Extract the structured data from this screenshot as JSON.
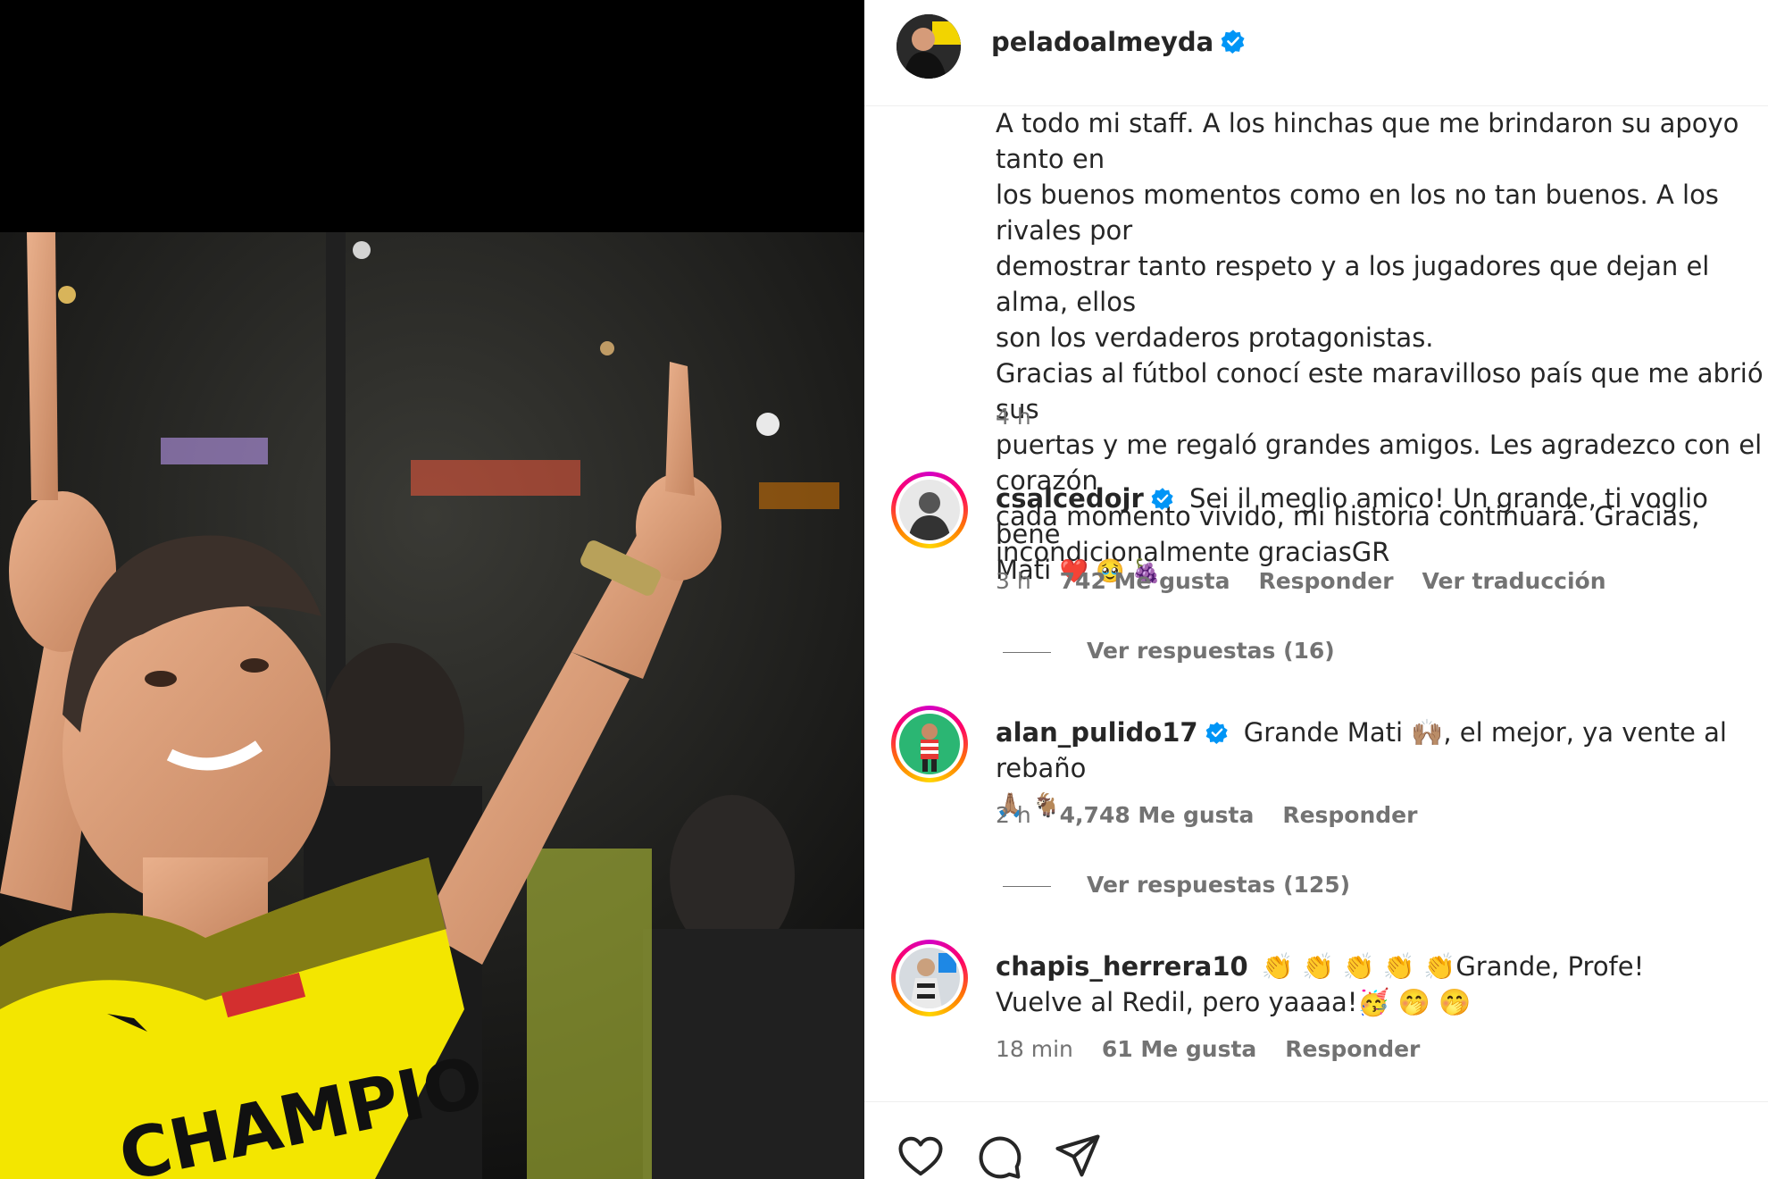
{
  "post": {
    "username": "peladoalmeyda",
    "caption": "A todo mi staff. A los hinchas que me brindaron su apoyo tanto en\nlos buenos momentos como en los no tan buenos. A los rivales por\ndemostrar tanto respeto y a los jugadores que dejan el alma, ellos\nson los verdaderos protagonistas.\nGracias al fútbol conocí este maravilloso país que me abrió sus\npuertas y me regaló grandes amigos. Les agradezco con el corazón\ncada momento vivido, mi historia continuará. Gracias,\nincondicionalmente graciasGR",
    "time": "4 h"
  },
  "comments": [
    {
      "username": "csalcedojr",
      "text": "Sei il meglio amico! Un grande, ti voglio bene",
      "text2": "Mati",
      "emoji": "❤️ 🥹 🍇",
      "time": "3 h",
      "likes": "742 Me gusta",
      "reply": "Responder",
      "translate": "Ver traducción",
      "view_replies": "Ver respuestas (16)"
    },
    {
      "username": "alan_pulido17",
      "text": "Grande Mati 🙌🏽, el mejor, ya vente al rebaño",
      "emoji": "🙏🏽 🐐",
      "time": "2 h",
      "likes": "4,748 Me gusta",
      "reply": "Responder",
      "view_replies": "Ver respuestas (125)"
    },
    {
      "username": "chapis_herrera10",
      "text": "👏 👏 👏 👏 👏Grande, Profe!",
      "text2": "Vuelve al Redil, pero yaaaa!🥳 🤭 🤭",
      "time": "18 min",
      "likes": "61 Me gusta",
      "reply": "Responder"
    }
  ],
  "icons": [
    "verified-badge",
    "heart-icon",
    "comment-icon",
    "share-icon"
  ],
  "colors": {
    "verified": "#0095f6",
    "muted": "#737373",
    "jersey": "#f3e600"
  }
}
